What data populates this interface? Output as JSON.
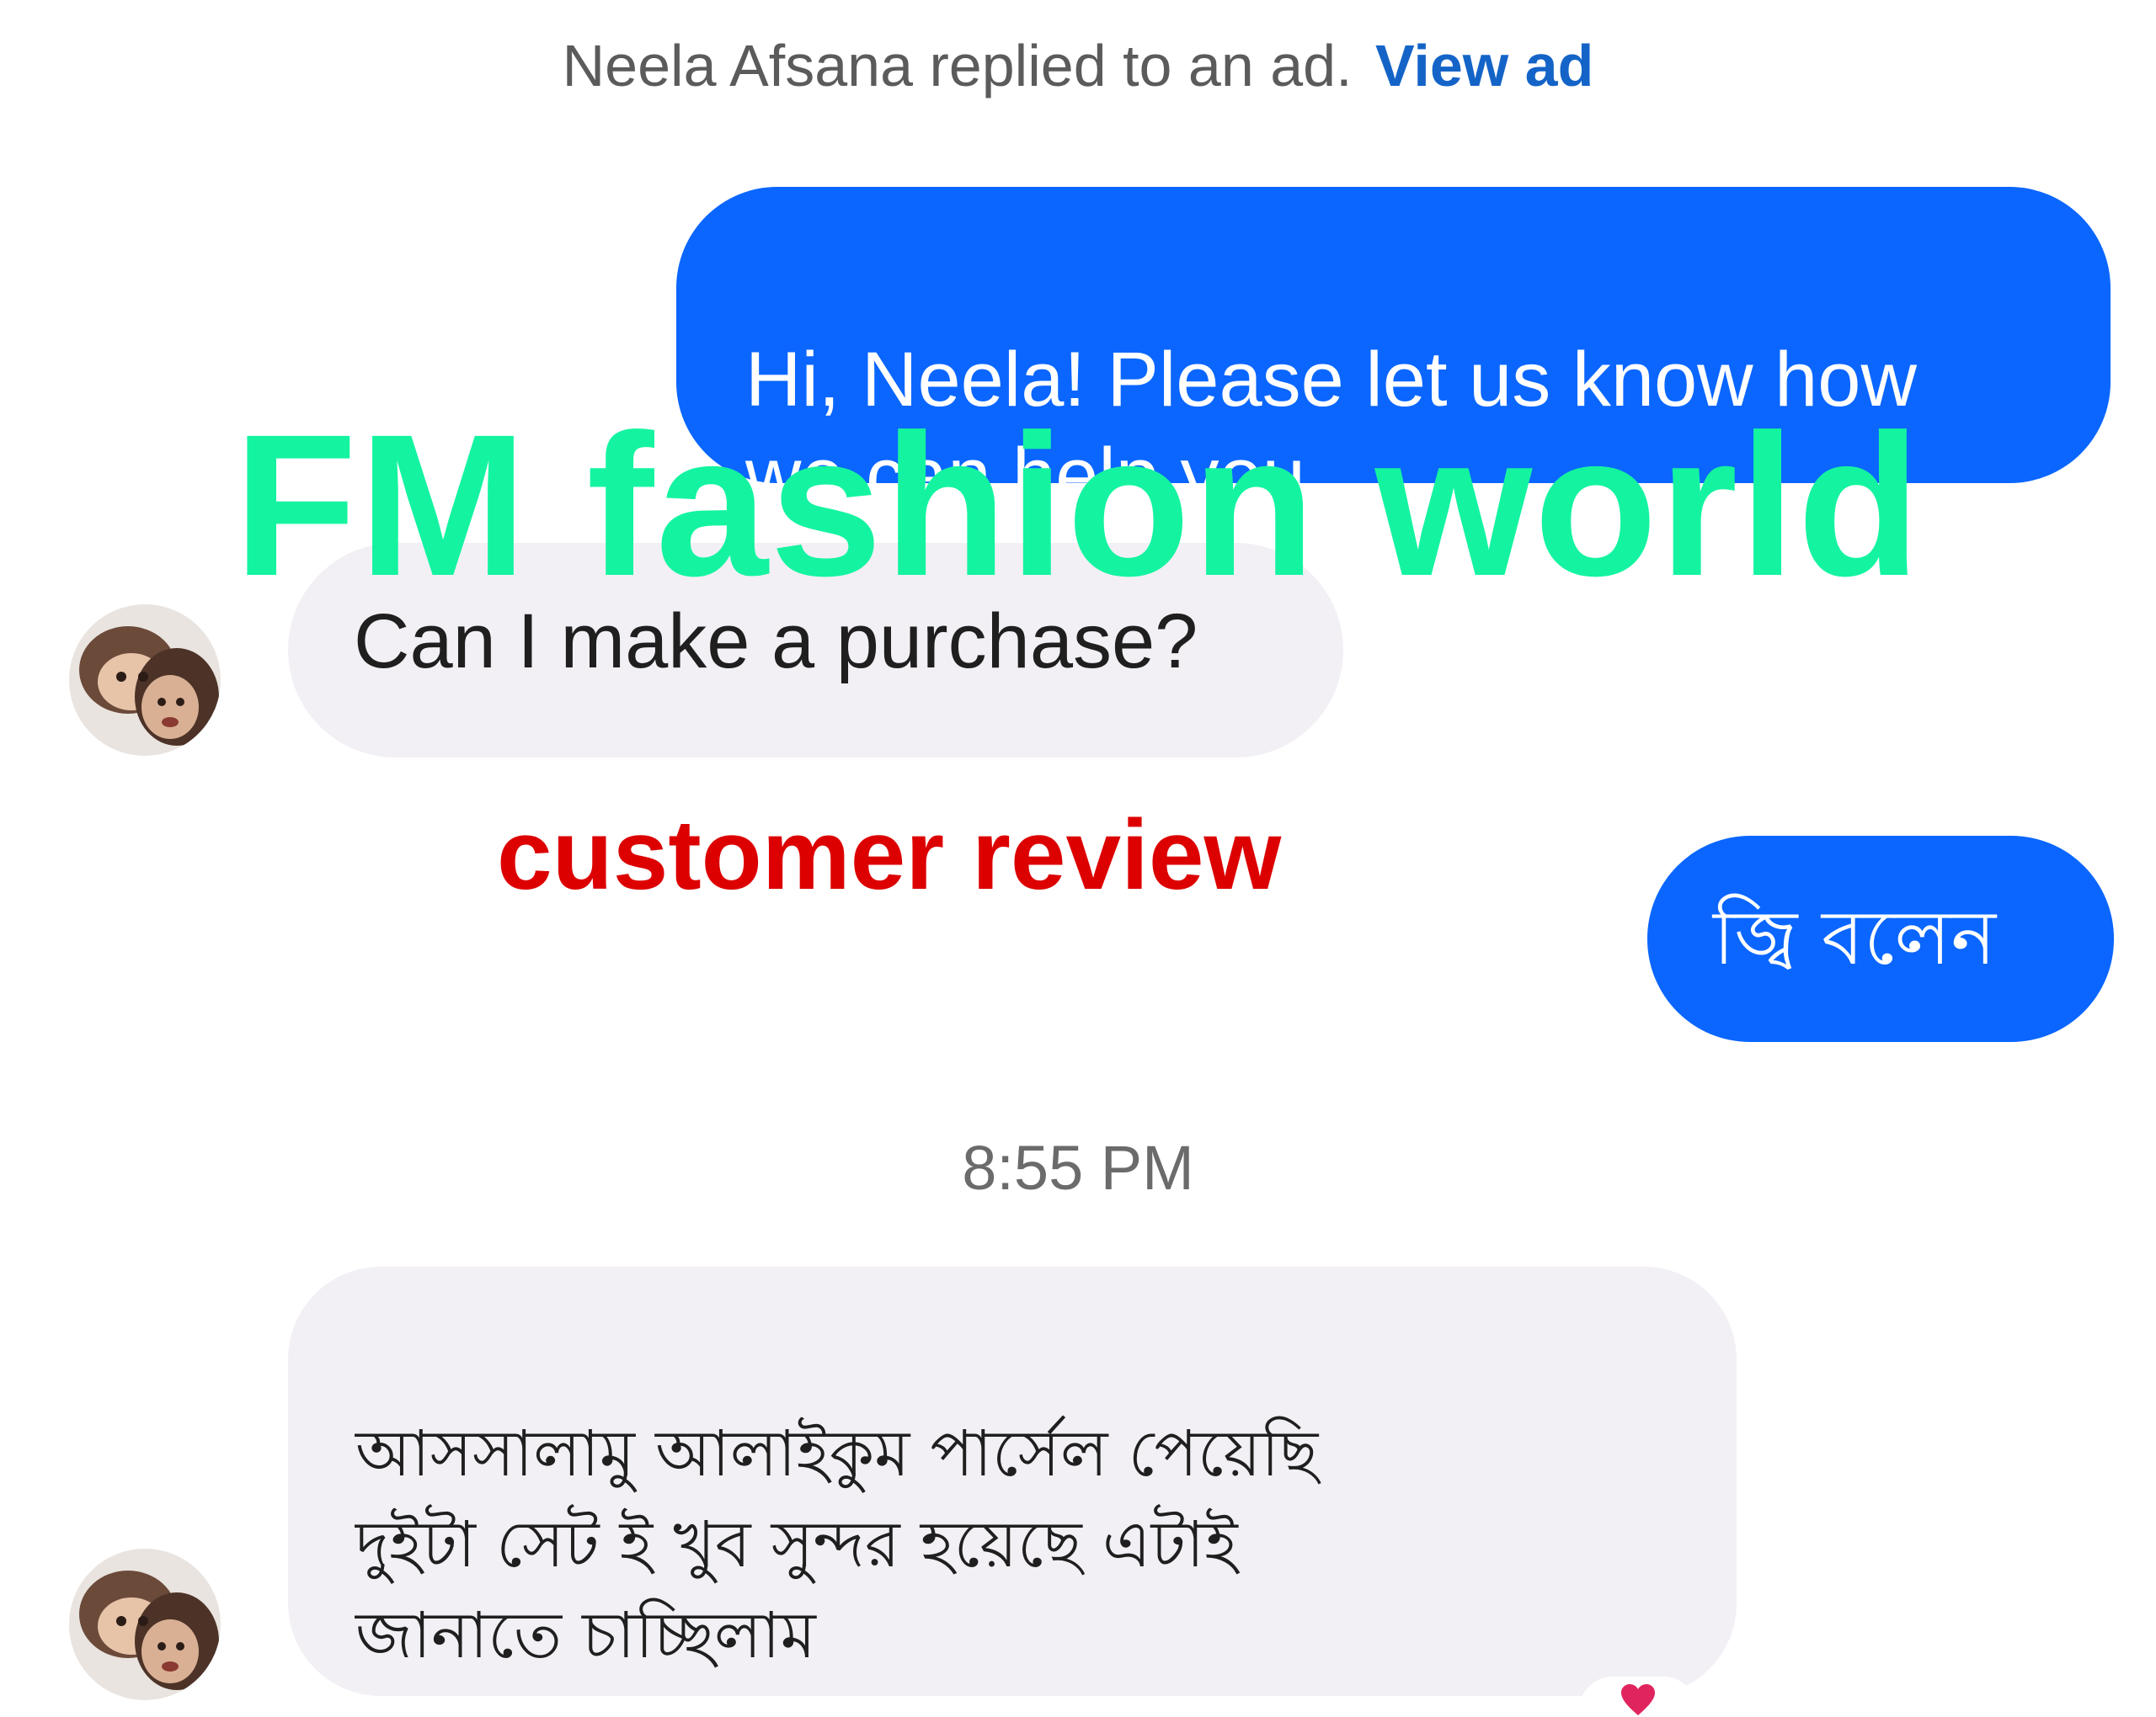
{
  "notice": {
    "text": "Neela Afsana replied to an ad.",
    "link": "View ad"
  },
  "messages": [
    {
      "direction": "outgoing",
      "text": "Hi, Neela! Please let us know how\nwe can help you."
    },
    {
      "direction": "incoming",
      "text": "Can I make a purchase?"
    },
    {
      "direction": "outgoing",
      "text": "জ্বি বলেন"
    },
    {
      "direction": "incoming",
      "text": "আসসালামু আলাইকুম পার্সেল পেয়েছি\nদুইটা সেট ই খুব সুন্দর হয়েছে এটাই\nজানাতে চাচ্ছিলাম"
    }
  ],
  "timestamp": "8:55 PM",
  "overlay": {
    "watermark": "FM fashion world",
    "caption": "customer review"
  },
  "colors": {
    "outgoing_bubble": "#0a66ff",
    "incoming_bubble": "#f2f0f5",
    "link": "#1464c8",
    "watermark": "#14f4a0",
    "caption": "#dd0000",
    "reaction": "#e0245e"
  },
  "icons": {
    "avatar": "user-avatar-photo",
    "reaction": "heart-icon"
  }
}
